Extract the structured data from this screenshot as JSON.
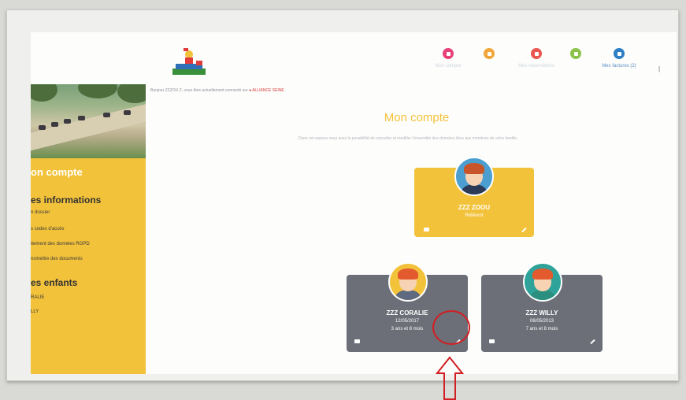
{
  "nav": {
    "items": [
      {
        "label": "Mon compte",
        "color": "#e8417a"
      },
      {
        "label": "",
        "color": "#f0a63a"
      },
      {
        "label": "Mes réservations",
        "color": "#e8564f"
      },
      {
        "label": "",
        "color": "#8bc34a"
      },
      {
        "label": "Mes factures (2)",
        "color": "#2c7fc7"
      }
    ]
  },
  "greeting": {
    "text": "Bonjour ZZZOU Z, vous êtes actuellement connecté sur ",
    "link": "● ALLIANCE SEINE"
  },
  "sidebar": {
    "title": "on compte",
    "section1": "es informations",
    "links1": [
      "n dossier",
      "s codes d'accès",
      "itement des données RGPD",
      "nsmettre des documents"
    ],
    "section2": "es enfants",
    "links2": [
      "RALIE",
      "LLY"
    ]
  },
  "main": {
    "title": "Mon compte",
    "subtitle": "Dans cet espace vous avez la possibilité de consulter et modifier l'ensemble des données liées aux membres de votre famille."
  },
  "cards": [
    {
      "name": "ZZZ ZOOU",
      "line1": "Référent",
      "line2": "",
      "color": "#f3c23b"
    },
    {
      "name": "ZZZ CORALIE",
      "line1": "12/05/2017",
      "line2": "3 ans et 8 mois",
      "color": "#6c6f78"
    },
    {
      "name": "ZZZ WILLY",
      "line1": "06/05/2013",
      "line2": "7 ans et 8 mois",
      "color": "#6c6f78"
    }
  ],
  "annotation_color": "#d11f23"
}
